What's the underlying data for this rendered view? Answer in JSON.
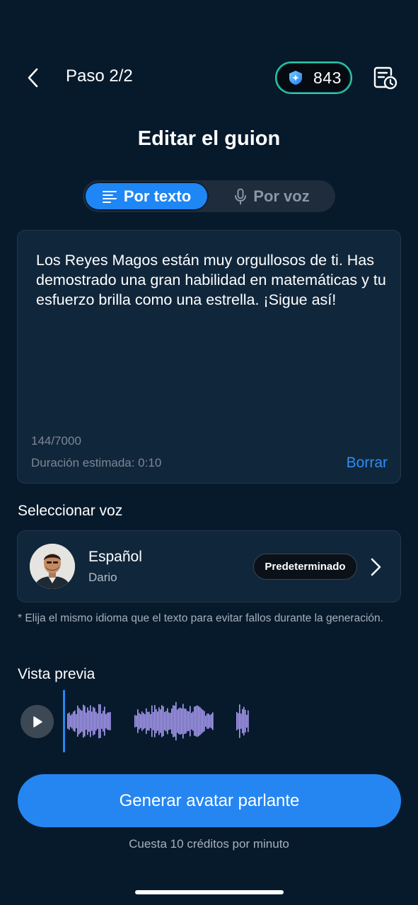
{
  "header": {
    "step": "Paso 2/2",
    "credits": "843",
    "back_icon": "chevron-left-icon",
    "history_icon": "history-clock-icon",
    "gem_icon": "gem-icon"
  },
  "title": "Editar el guion",
  "mode_toggle": {
    "options": [
      {
        "label": "Por texto",
        "icon": "text-lines-icon",
        "selected": true
      },
      {
        "label": "Por voz",
        "icon": "microphone-icon",
        "selected": false
      }
    ]
  },
  "script": {
    "text": "Los Reyes Magos están muy orgullosos de ti. Has demostrado una gran habilidad en matemáticas y tu esfuerzo brilla como una estrella. ¡Sigue así!",
    "char_count": "144/7000",
    "duration": "Duración estimada: 0:10",
    "clear_label": "Borrar"
  },
  "voice": {
    "section_label": "Seleccionar voz",
    "language": "Español",
    "name": "Dario",
    "badge": "Predeterminado",
    "note": "* Elija el mismo idioma que el texto para evitar fallos durante la generación."
  },
  "preview": {
    "label": "Vista previa",
    "play_icon": "play-icon"
  },
  "actions": {
    "generate_label": "Generar avatar parlante",
    "cost_note": "Cuesta 10 créditos por minuto"
  },
  "colors": {
    "background": "#071a2c",
    "card": "#10263b",
    "accent": "#2586f2",
    "waveform": "#a99cf5",
    "credits_border": "#2ec9a4"
  }
}
